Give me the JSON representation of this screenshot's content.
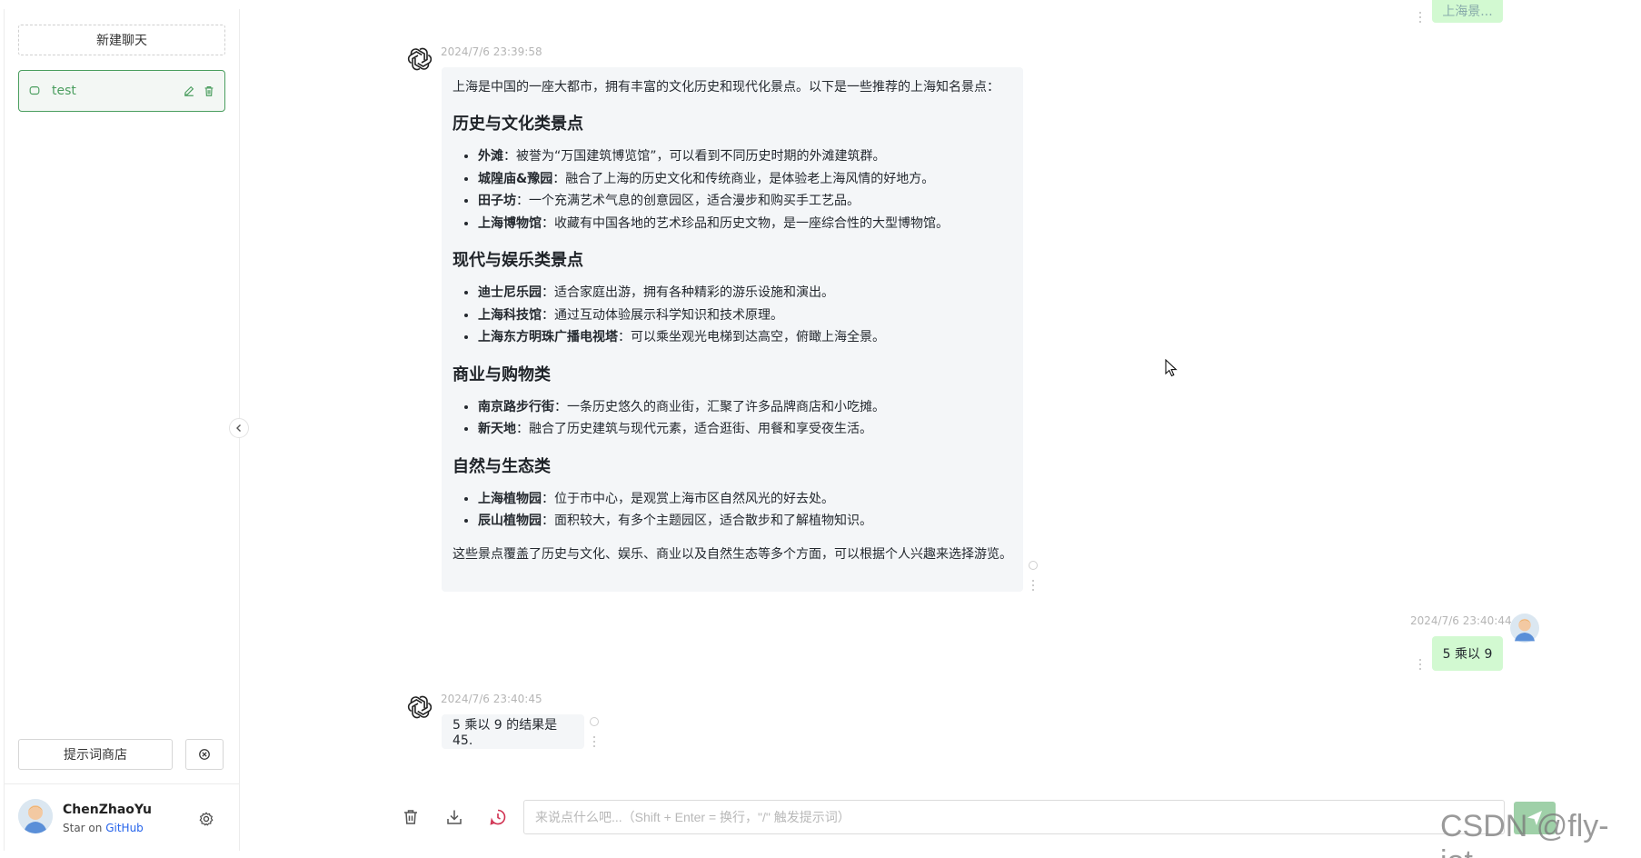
{
  "sidebar": {
    "new_chat_label": "新建聊天",
    "chats": [
      {
        "label": "test"
      }
    ],
    "prompt_store_label": "提示词商店",
    "user": {
      "name": "ChenZhaoYu",
      "star_prefix": "Star on",
      "star_link": "GitHub"
    }
  },
  "messages": {
    "top_partial_user": {
      "text": "上海景..."
    },
    "bot1": {
      "time": "2024/7/6 23:39:58",
      "intro": "上海是中国的一座大都市，拥有丰富的文化历史和现代化景点。以下是一些推荐的上海知名景点：",
      "sections": [
        {
          "heading": "历史与文化类景点",
          "items": [
            {
              "name": "外滩",
              "desc": "：被誉为“万国建筑博览馆”，可以看到不同历史时期的外滩建筑群。"
            },
            {
              "name": "城隍庙&豫园",
              "desc": "：融合了上海的历史文化和传统商业，是体验老上海风情的好地方。"
            },
            {
              "name": "田子坊",
              "desc": "：一个充满艺术气息的创意园区，适合漫步和购买手工艺品。"
            },
            {
              "name": "上海博物馆",
              "desc": "：收藏有中国各地的艺术珍品和历史文物，是一座综合性的大型博物馆。"
            }
          ]
        },
        {
          "heading": "现代与娱乐类景点",
          "items": [
            {
              "name": "迪士尼乐园",
              "desc": "：适合家庭出游，拥有各种精彩的游乐设施和演出。"
            },
            {
              "name": "上海科技馆",
              "desc": "：通过互动体验展示科学知识和技术原理。"
            },
            {
              "name": "上海东方明珠广播电视塔",
              "desc": "：可以乘坐观光电梯到达高空，俯瞰上海全景。"
            }
          ]
        },
        {
          "heading": "商业与购物类",
          "items": [
            {
              "name": "南京路步行街",
              "desc": "：一条历史悠久的商业街，汇聚了许多品牌商店和小吃摊。"
            },
            {
              "name": "新天地",
              "desc": "：融合了历史建筑与现代元素，适合逛街、用餐和享受夜生活。"
            }
          ]
        },
        {
          "heading": "自然与生态类",
          "items": [
            {
              "name": "上海植物园",
              "desc": "：位于市中心，是观赏上海市区自然风光的好去处。"
            },
            {
              "name": "辰山植物园",
              "desc": "：面积较大，有多个主题园区，适合散步和了解植物知识。"
            }
          ]
        }
      ],
      "outro": "这些景点覆盖了历史与文化、娱乐、商业以及自然生态等多个方面，可以根据个人兴趣来选择游览。"
    },
    "user2": {
      "time": "2024/7/6 23:40:44",
      "text": "5 乘以 9"
    },
    "bot2": {
      "time": "2024/7/6 23:40:45",
      "text": "5 乘以 9 的结果是 45."
    }
  },
  "input": {
    "placeholder": "来说点什么吧...（Shift + Enter = 换行，\"/\" 触发提示词）",
    "value": ""
  },
  "watermark": "CSDN @fly-iot",
  "icons": {
    "chat": "chat-bubble-icon",
    "edit": "edit-icon",
    "delete": "trash-icon",
    "clear": "clear-icon",
    "settings": "gear-icon",
    "collapse": "chevron-left-icon",
    "openai": "openai-logo-icon",
    "download": "download-icon",
    "history": "history-icon",
    "send": "send-icon"
  },
  "colors": {
    "accent": "#4b9e5f",
    "user_bubble": "#d2f9d1",
    "bot_bubble": "#f4f6f8",
    "history_icon": "#d03050"
  }
}
